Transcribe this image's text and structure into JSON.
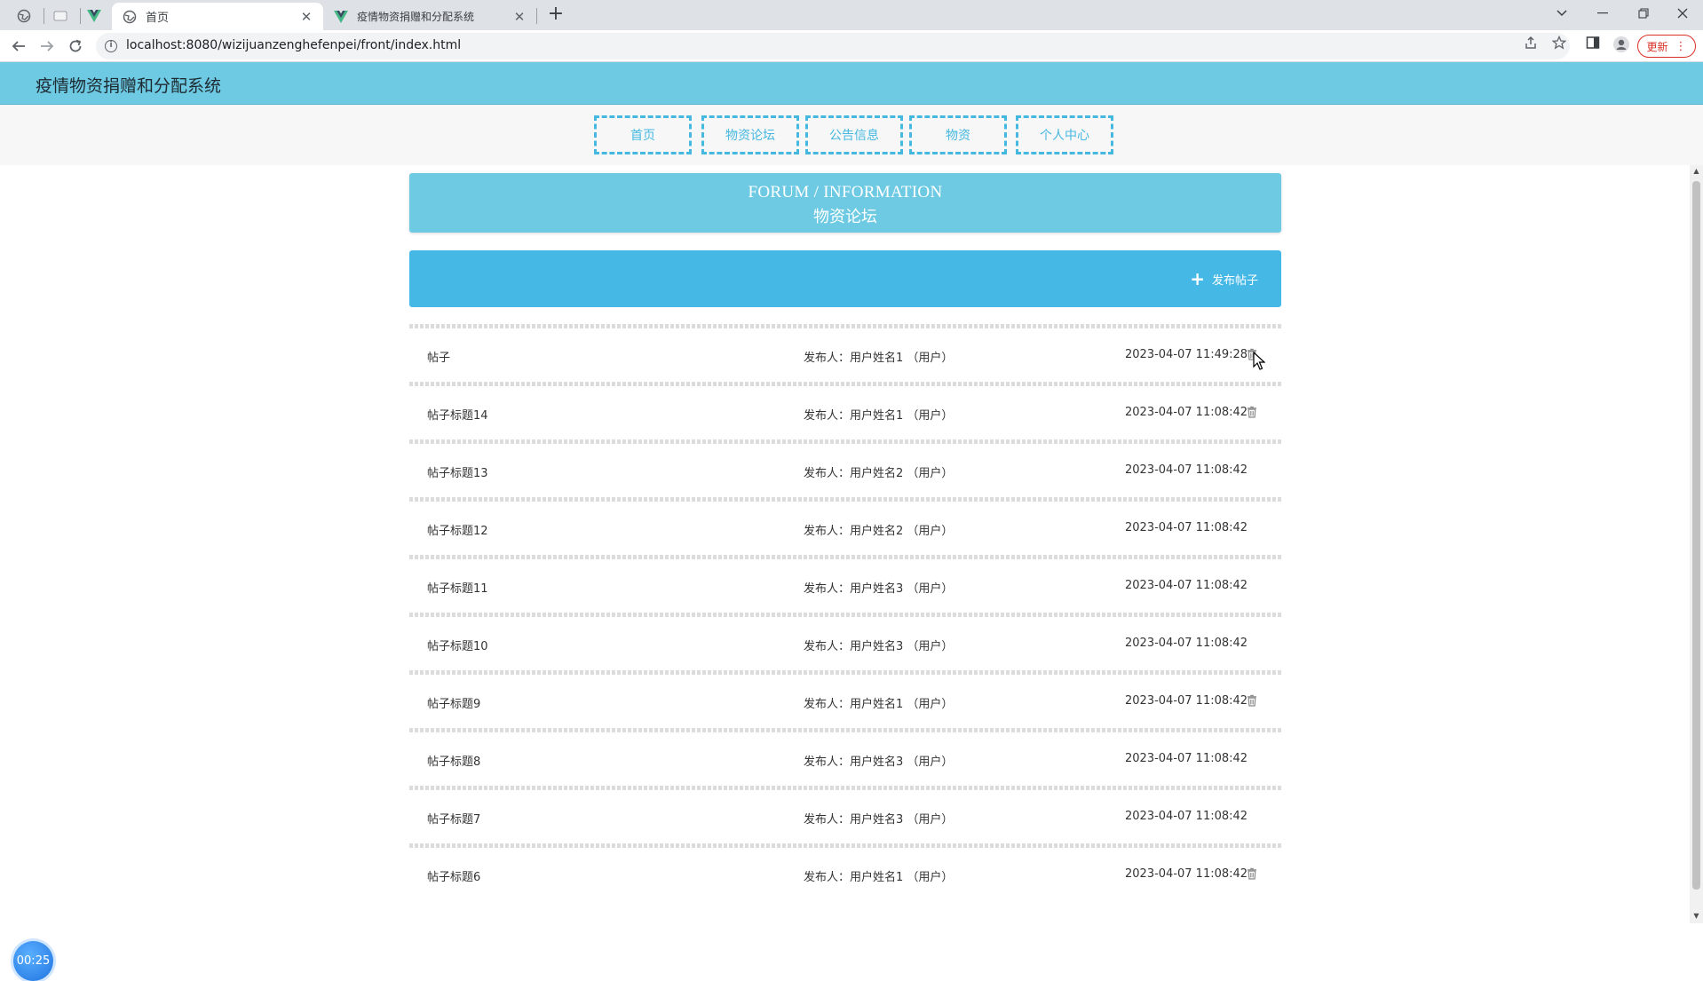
{
  "browser": {
    "tabs": [
      {
        "title": "首页",
        "active": true,
        "icon": "globe-icon"
      },
      {
        "title": "疫情物资捐赠和分配系统",
        "active": false,
        "icon": "vue-icon"
      }
    ],
    "close_glyph": "✕",
    "new_tab_glyph": "+",
    "url": "localhost:8080/wizijuanzenghefenpei/front/index.html",
    "update_label": "更新"
  },
  "site": {
    "title": "疫情物资捐赠和分配系统",
    "nav": [
      "首页",
      "物资论坛",
      "公告信息",
      "物资",
      "个人中心"
    ]
  },
  "banner": {
    "en": "FORUM / INFORMATION",
    "zh": "物资论坛"
  },
  "actions": {
    "post_label": "发布帖子",
    "plus_glyph": "+"
  },
  "posts": [
    {
      "title": "帖子",
      "author": "发布人：用户姓名1 （用户）",
      "time": "2023-04-07 11:49:28",
      "deletable": true
    },
    {
      "title": "帖子标题14",
      "author": "发布人：用户姓名1 （用户）",
      "time": "2023-04-07 11:08:42",
      "deletable": true
    },
    {
      "title": "帖子标题13",
      "author": "发布人：用户姓名2 （用户）",
      "time": "2023-04-07 11:08:42",
      "deletable": false
    },
    {
      "title": "帖子标题12",
      "author": "发布人：用户姓名2 （用户）",
      "time": "2023-04-07 11:08:42",
      "deletable": false
    },
    {
      "title": "帖子标题11",
      "author": "发布人：用户姓名3 （用户）",
      "time": "2023-04-07 11:08:42",
      "deletable": false
    },
    {
      "title": "帖子标题10",
      "author": "发布人：用户姓名3 （用户）",
      "time": "2023-04-07 11:08:42",
      "deletable": false
    },
    {
      "title": "帖子标题9",
      "author": "发布人：用户姓名1 （用户）",
      "time": "2023-04-07 11:08:42",
      "deletable": true
    },
    {
      "title": "帖子标题8",
      "author": "发布人：用户姓名3 （用户）",
      "time": "2023-04-07 11:08:42",
      "deletable": false
    },
    {
      "title": "帖子标题7",
      "author": "发布人：用户姓名3 （用户）",
      "time": "2023-04-07 11:08:42",
      "deletable": false
    },
    {
      "title": "帖子标题6",
      "author": "发布人：用户姓名1 （用户）",
      "time": "2023-04-07 11:08:42",
      "deletable": true
    }
  ],
  "timer": "00:25",
  "colors": {
    "header": "#6ecae3",
    "accent": "#45b8e6",
    "nav_border": "#45b8e0"
  }
}
